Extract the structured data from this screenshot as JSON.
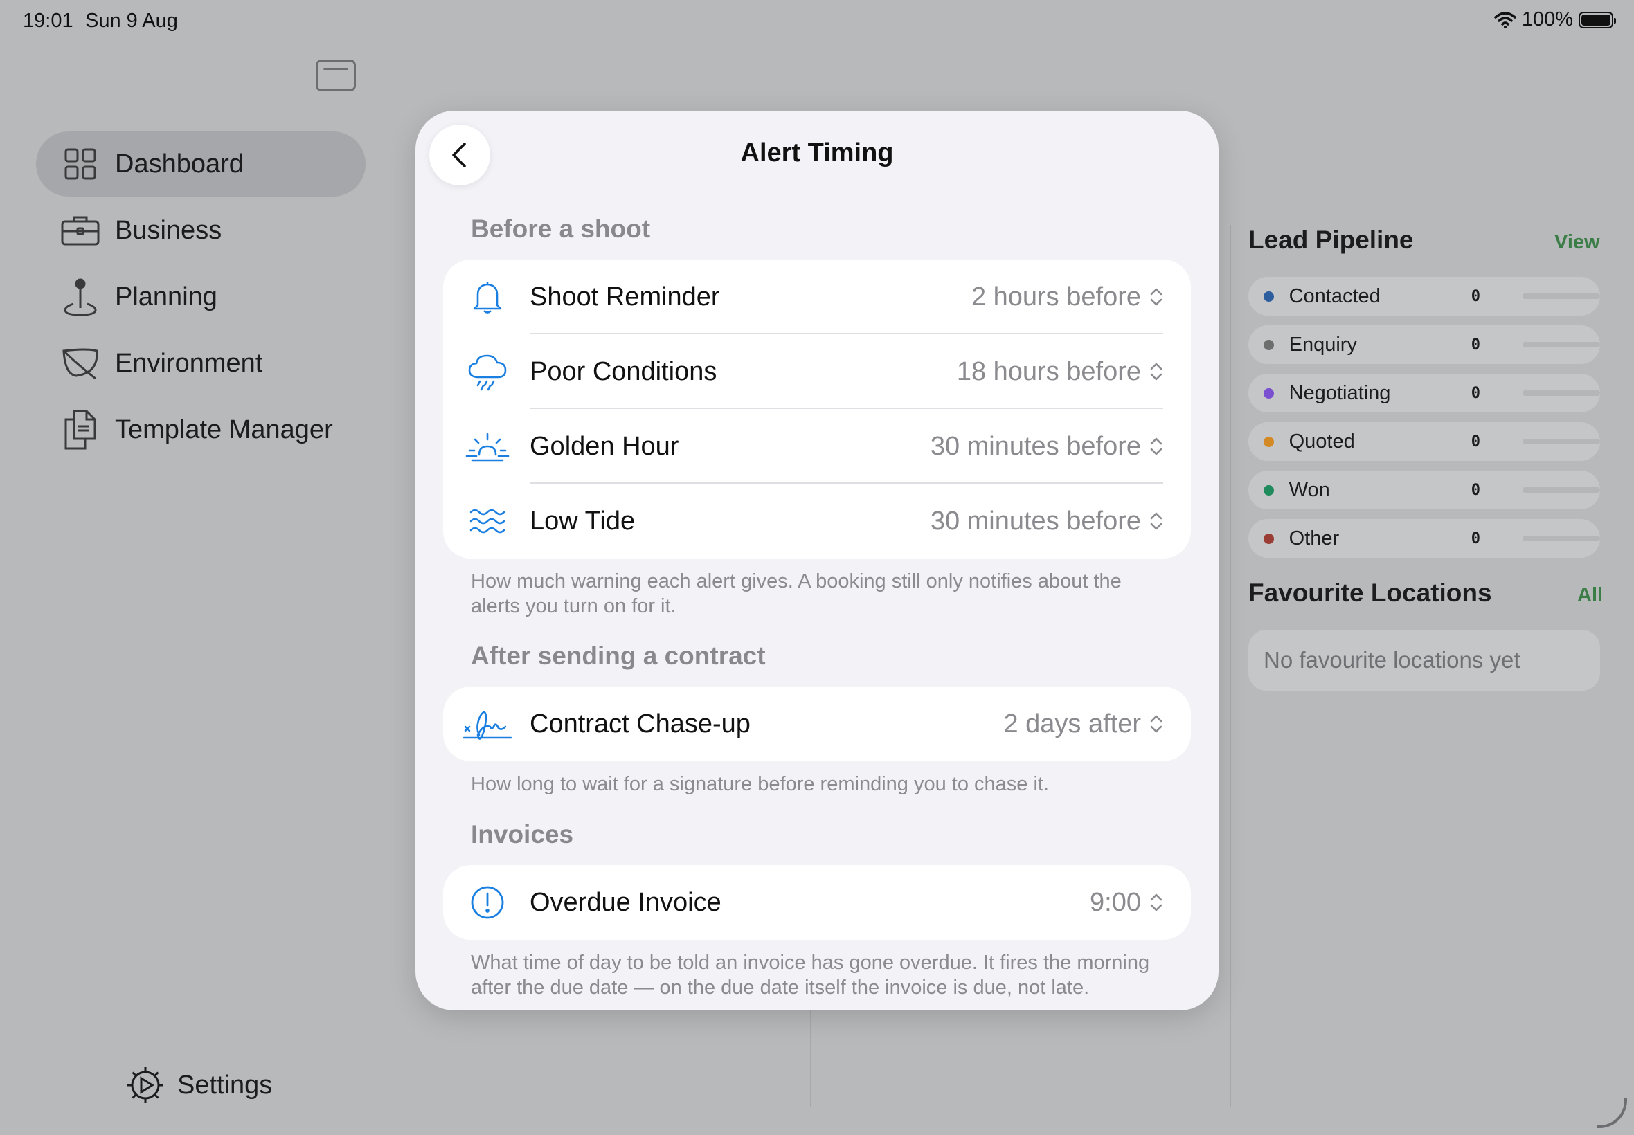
{
  "status": {
    "time": "19:01",
    "date": "Sun 9 Aug",
    "battery": "100%"
  },
  "sidebar": {
    "items": [
      {
        "label": "Dashboard",
        "icon": "grid-icon",
        "active": true
      },
      {
        "label": "Business",
        "icon": "briefcase-icon"
      },
      {
        "label": "Planning",
        "icon": "map-pin-icon"
      },
      {
        "label": "Environment",
        "icon": "leaf-icon"
      },
      {
        "label": "Template Manager",
        "icon": "documents-icon"
      }
    ],
    "settings_label": "Settings"
  },
  "right_panel": {
    "pipeline_title": "Lead Pipeline",
    "pipeline_link": "View",
    "pipeline": [
      {
        "label": "Contacted",
        "count": "0",
        "color": "#2c5d9c"
      },
      {
        "label": "Enquiry",
        "count": "0",
        "color": "#6b6e6d"
      },
      {
        "label": "Negotiating",
        "count": "0",
        "color": "#7a4fd0"
      },
      {
        "label": "Quoted",
        "count": "0",
        "color": "#d48a24"
      },
      {
        "label": "Won",
        "count": "0",
        "color": "#1f8a5c"
      },
      {
        "label": "Other",
        "count": "0",
        "color": "#9a3d34"
      }
    ],
    "favourites_title": "Favourite Locations",
    "favourites_link": "All",
    "favourites_empty": "No favourite locations yet"
  },
  "modal": {
    "title": "Alert Timing",
    "sections": [
      {
        "header": "Before a shoot",
        "rows": [
          {
            "label": "Shoot Reminder",
            "value": "2 hours before",
            "icon": "bell-icon"
          },
          {
            "label": "Poor Conditions",
            "value": "18 hours before",
            "icon": "cloud-rain-icon"
          },
          {
            "label": "Golden Hour",
            "value": "30 minutes before",
            "icon": "sunrise-icon"
          },
          {
            "label": "Low Tide",
            "value": "30 minutes before",
            "icon": "waves-icon"
          }
        ],
        "footnote": "How much warning each alert gives. A booking still only notifies about the alerts you turn on for it."
      },
      {
        "header": "After sending a contract",
        "rows": [
          {
            "label": "Contract Chase-up",
            "value": "2 days after",
            "icon": "signature-icon"
          }
        ],
        "footnote": "How long to wait for a signature before reminding you to chase it."
      },
      {
        "header": "Invoices",
        "rows": [
          {
            "label": "Overdue Invoice",
            "value": "9:00",
            "icon": "exclamation-circle-icon"
          }
        ],
        "footnote": "What time of day to be told an invoice has gone overdue. It fires the morning after the due date — on the due date itself the invoice is due, not late."
      }
    ]
  },
  "colors": {
    "accent": "#1a7fe0",
    "link_green": "#3a7d46"
  }
}
